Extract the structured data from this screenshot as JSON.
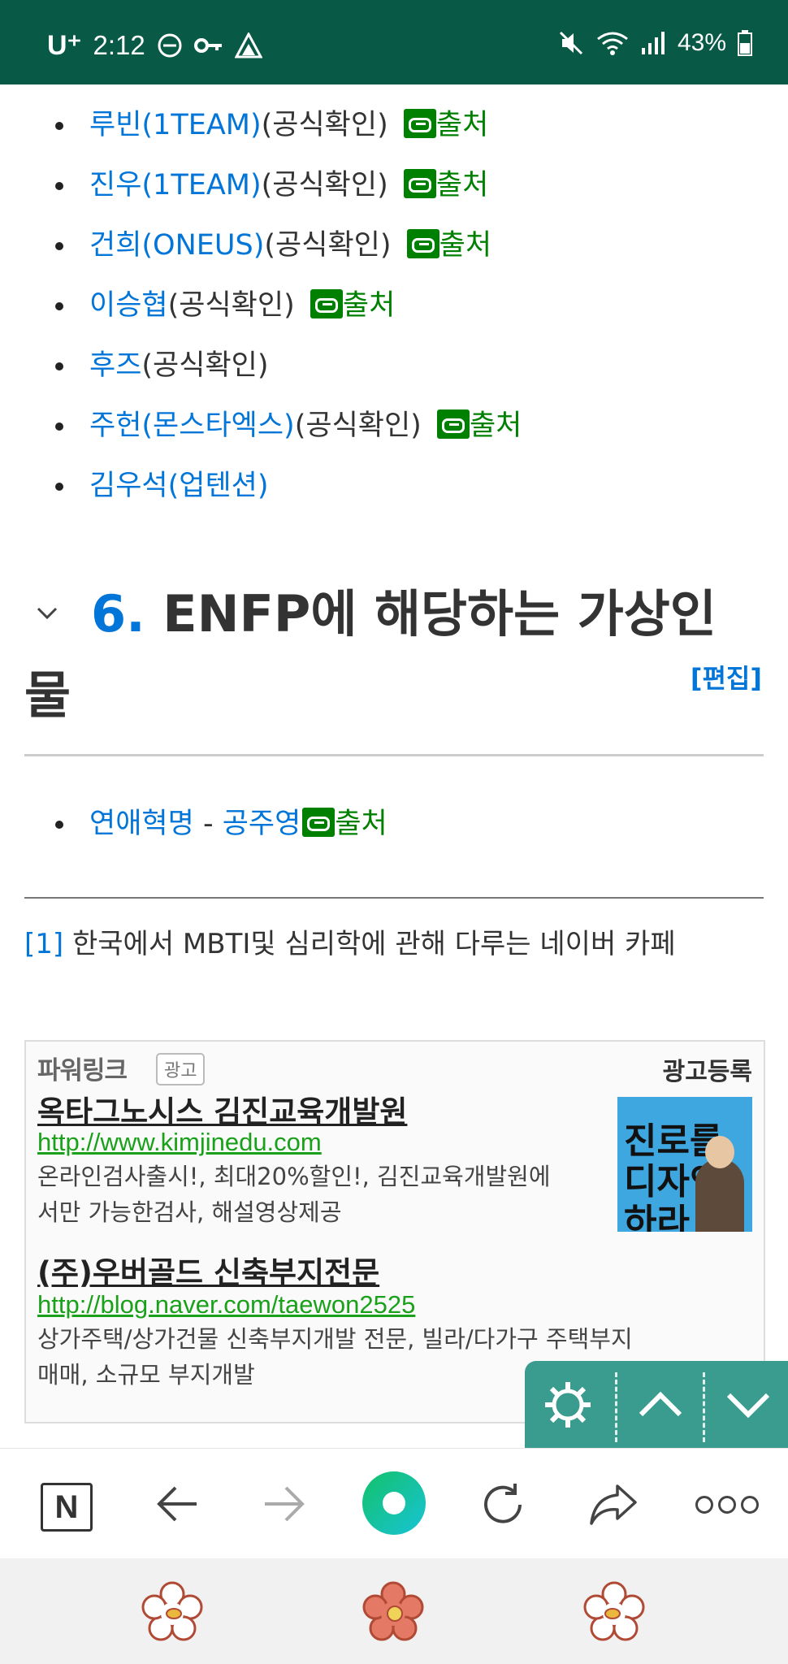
{
  "status_bar": {
    "carrier": "U⁺",
    "time": "2:12",
    "battery": "43%"
  },
  "persons": [
    {
      "name": "루빈(1TEAM)",
      "note": "(공식확인)",
      "source": "출처"
    },
    {
      "name": "진우(1TEAM)",
      "note": "(공식확인)",
      "source": "출처"
    },
    {
      "name": "건희(ONEUS)",
      "note": "(공식확인)",
      "source": "출처"
    },
    {
      "name": "이승협",
      "note": "(공식확인)",
      "source": "출처"
    },
    {
      "name": "후즈",
      "note": "(공식확인)",
      "source": ""
    },
    {
      "name": "주헌(몬스타엑스)",
      "note": "(공식확인)",
      "source": "출처"
    },
    {
      "name": "김우석(업텐션)",
      "note": "",
      "source": ""
    }
  ],
  "section": {
    "number": "6.",
    "title": "ENFP에 해당하는 가상인물",
    "edit_label": "[편집]"
  },
  "fictional": {
    "work": "연애혁명",
    "separator": " - ",
    "character": "공주영",
    "source": "출처"
  },
  "footnote": {
    "ref": "[1]",
    "text": " 한국에서 MBTI및 심리학에 관해 다루는 네이버 카페"
  },
  "ad": {
    "header_title": "파워링크",
    "badge": "광고",
    "register": "광고등록",
    "items": [
      {
        "title": "옥타그노시스 김진교육개발원",
        "url": "http://www.kimjinedu.com",
        "desc_line1": "온라인검사출시!, 최대20%할인!, 김진교육개발원에",
        "desc_line2": "서만 가능한검사, 해설영상제공"
      },
      {
        "title": "(주)우버골드 신축부지전문",
        "url": "http://blog.naver.com/taewon2525",
        "desc_line1": "상가주택/상가건물 신축부지개발 전문, 빌라/다가구 주택부지",
        "desc_line2": "매매, 소규모 부지개발"
      }
    ],
    "book_title_line1": "진로를",
    "book_title_line2": "디자인",
    "book_title_line3": "하라"
  },
  "browser_bar": {
    "n_label": "N"
  },
  "colors": {
    "status_bg": "#085a47",
    "link": "#0275d8",
    "external_link": "#008000",
    "float_panel": "#3a9b8f"
  }
}
